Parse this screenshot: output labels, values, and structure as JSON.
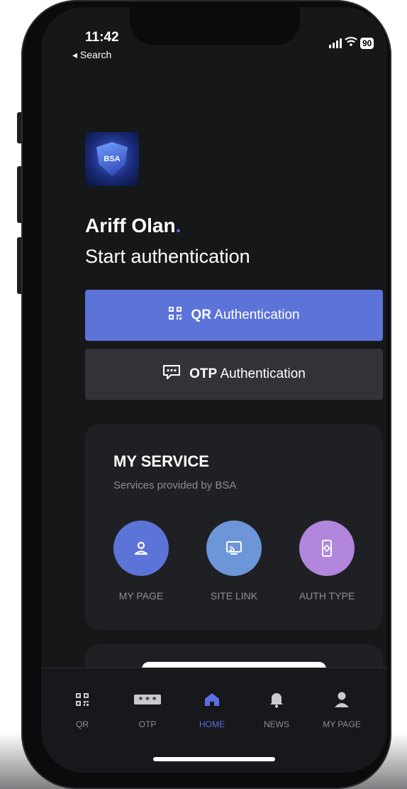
{
  "status": {
    "time": "11:42",
    "back_label": "◂ Search",
    "battery": "90"
  },
  "logo": {
    "text": "BSA"
  },
  "user": {
    "name": "Ariff Olan",
    "subtitle": "Start authentication"
  },
  "buttons": {
    "qr": {
      "bold": "QR",
      "rest": "Authentication"
    },
    "otp": {
      "bold": "OTP",
      "rest": "Authentication"
    }
  },
  "service": {
    "title": "MY SERVICE",
    "subtitle": "Services provided by BSA",
    "items": [
      {
        "label": "MY PAGE",
        "icon": "person-icon",
        "color": "#5c73d8"
      },
      {
        "label": "SITE LINK",
        "icon": "cast-icon",
        "color": "#6d96d8"
      },
      {
        "label": "AUTH TYPE",
        "icon": "phone-gear-icon",
        "color": "#b386dd"
      }
    ]
  },
  "tabbar": {
    "items": [
      {
        "label": "QR",
        "icon": "qr-icon"
      },
      {
        "label": "OTP",
        "icon": "otp-icon"
      },
      {
        "label": "HOME",
        "icon": "home-icon",
        "active": true
      },
      {
        "label": "NEWS",
        "icon": "bell-icon"
      },
      {
        "label": "MY PAGE",
        "icon": "person-icon"
      }
    ]
  },
  "colors": {
    "accent": "#5c73d8",
    "background": "#161719",
    "card": "#1f2024"
  }
}
